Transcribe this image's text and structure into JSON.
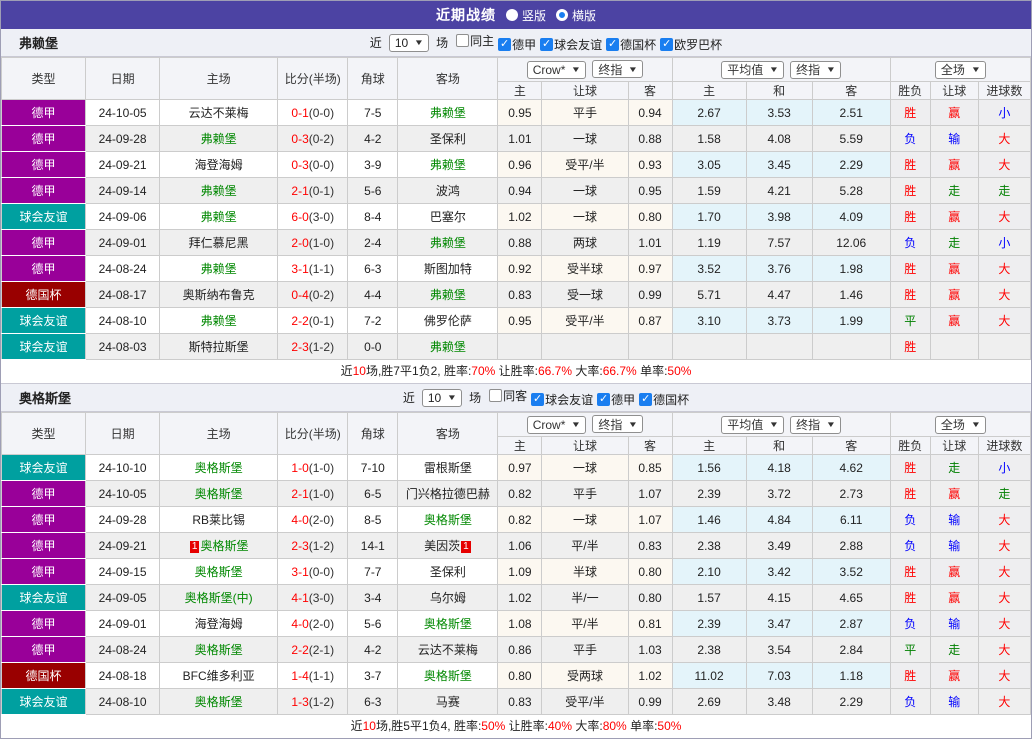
{
  "title_bar": {
    "title": "近期战绩",
    "radios": [
      {
        "label": "竖版",
        "checked": false
      },
      {
        "label": "横版",
        "checked": true
      }
    ]
  },
  "table": {
    "columns": {
      "left": [
        "类型",
        "日期",
        "主场",
        "比分(半场)",
        "角球",
        "客场"
      ],
      "sub": [
        "主",
        "让球",
        "客",
        "主",
        "和",
        "客",
        "胜负",
        "让球",
        "进球数"
      ]
    },
    "select_groups": [
      [
        "Crow*",
        "终指"
      ],
      [
        "平均值",
        "终指"
      ],
      [
        "全场"
      ]
    ]
  },
  "colors": {
    "titlebar": "#4c43a3",
    "type_badge": {
      "德甲": "#990099",
      "球会友谊": "#00a0a0",
      "德国杯": "#990000"
    },
    "result_text": {
      "胜": "#ff0000",
      "赢": "#ff0000",
      "大": "#ff0000",
      "负": "#0000ff",
      "输": "#0000ff",
      "小": "#0000ff",
      "平": "#008000",
      "走": "#008000"
    },
    "team_highlight": "#008800",
    "score_fulltime": "#ff0000"
  },
  "sections": [
    {
      "team": "弗赖堡",
      "filters": {
        "near_label": "近",
        "count": "10",
        "unit_label": "场",
        "checks": [
          {
            "label": "同主",
            "checked": false
          },
          {
            "label": "德甲",
            "checked": true
          },
          {
            "label": "球会友谊",
            "checked": true
          },
          {
            "label": "德国杯",
            "checked": true
          },
          {
            "label": "欧罗巴杯",
            "checked": true
          }
        ]
      },
      "rows": [
        {
          "type": "德甲",
          "date": "24-10-05",
          "home": {
            "name": "云达不莱梅"
          },
          "score": {
            "ft": "0-1",
            "ht": "(0-0)"
          },
          "corner": "7-5",
          "away": {
            "name": "弗赖堡",
            "green": true
          },
          "odds": [
            "0.95",
            "平手",
            "0.94"
          ],
          "avg": [
            "2.67",
            "3.53",
            "2.51"
          ],
          "result": [
            "胜",
            "赢",
            "小"
          ]
        },
        {
          "type": "德甲",
          "date": "24-09-28",
          "home": {
            "name": "弗赖堡",
            "green": true
          },
          "score": {
            "ft": "0-3",
            "ht": "(0-2)"
          },
          "corner": "4-2",
          "away": {
            "name": "圣保利"
          },
          "odds": [
            "1.01",
            "一球",
            "0.88"
          ],
          "avg": [
            "1.58",
            "4.08",
            "5.59"
          ],
          "result": [
            "负",
            "输",
            "大"
          ]
        },
        {
          "type": "德甲",
          "date": "24-09-21",
          "home": {
            "name": "海登海姆"
          },
          "score": {
            "ft": "0-3",
            "ht": "(0-0)"
          },
          "corner": "3-9",
          "away": {
            "name": "弗赖堡",
            "green": true
          },
          "odds": [
            "0.96",
            "受平/半",
            "0.93"
          ],
          "avg": [
            "3.05",
            "3.45",
            "2.29"
          ],
          "result": [
            "胜",
            "赢",
            "大"
          ]
        },
        {
          "type": "德甲",
          "date": "24-09-14",
          "home": {
            "name": "弗赖堡",
            "green": true
          },
          "score": {
            "ft": "2-1",
            "ht": "(0-1)"
          },
          "corner": "5-6",
          "away": {
            "name": "波鸿"
          },
          "odds": [
            "0.94",
            "一球",
            "0.95"
          ],
          "avg": [
            "1.59",
            "4.21",
            "5.28"
          ],
          "result": [
            "胜",
            "走",
            "走"
          ]
        },
        {
          "type": "球会友谊",
          "date": "24-09-06",
          "home": {
            "name": "弗赖堡",
            "green": true
          },
          "score": {
            "ft": "6-0",
            "ht": "(3-0)"
          },
          "corner": "8-4",
          "away": {
            "name": "巴塞尔"
          },
          "odds": [
            "1.02",
            "一球",
            "0.80"
          ],
          "avg": [
            "1.70",
            "3.98",
            "4.09"
          ],
          "result": [
            "胜",
            "赢",
            "大"
          ]
        },
        {
          "type": "德甲",
          "date": "24-09-01",
          "home": {
            "name": "拜仁慕尼黑"
          },
          "score": {
            "ft": "2-0",
            "ht": "(1-0)"
          },
          "corner": "2-4",
          "away": {
            "name": "弗赖堡",
            "green": true
          },
          "odds": [
            "0.88",
            "两球",
            "1.01"
          ],
          "avg": [
            "1.19",
            "7.57",
            "12.06"
          ],
          "result": [
            "负",
            "走",
            "小"
          ]
        },
        {
          "type": "德甲",
          "date": "24-08-24",
          "home": {
            "name": "弗赖堡",
            "green": true
          },
          "score": {
            "ft": "3-1",
            "ht": "(1-1)"
          },
          "corner": "6-3",
          "away": {
            "name": "斯图加特"
          },
          "odds": [
            "0.92",
            "受半球",
            "0.97"
          ],
          "avg": [
            "3.52",
            "3.76",
            "1.98"
          ],
          "result": [
            "胜",
            "赢",
            "大"
          ]
        },
        {
          "type": "德国杯",
          "date": "24-08-17",
          "home": {
            "name": "奥斯纳布鲁克"
          },
          "score": {
            "ft": "0-4",
            "ht": "(0-2)"
          },
          "corner": "4-4",
          "away": {
            "name": "弗赖堡",
            "green": true
          },
          "odds": [
            "0.83",
            "受一球",
            "0.99"
          ],
          "avg": [
            "5.71",
            "4.47",
            "1.46"
          ],
          "result": [
            "胜",
            "赢",
            "大"
          ]
        },
        {
          "type": "球会友谊",
          "date": "24-08-10",
          "home": {
            "name": "弗赖堡",
            "green": true
          },
          "score": {
            "ft": "2-2",
            "ht": "(0-1)"
          },
          "corner": "7-2",
          "away": {
            "name": "佛罗伦萨"
          },
          "odds": [
            "0.95",
            "受平/半",
            "0.87"
          ],
          "avg": [
            "3.10",
            "3.73",
            "1.99"
          ],
          "result": [
            "平",
            "赢",
            "大"
          ]
        },
        {
          "type": "球会友谊",
          "date": "24-08-03",
          "home": {
            "name": "斯特拉斯堡"
          },
          "score": {
            "ft": "2-3",
            "ht": "(1-2)"
          },
          "corner": "0-0",
          "away": {
            "name": "弗赖堡",
            "green": true
          },
          "odds": [
            "",
            "",
            ""
          ],
          "avg": [
            "",
            "",
            ""
          ],
          "result": [
            "胜",
            "",
            ""
          ]
        }
      ],
      "summary": [
        {
          "text": "近"
        },
        {
          "text": "10",
          "red": true
        },
        {
          "text": "场,胜7平1负2, 胜率:"
        },
        {
          "text": "70%",
          "red": true
        },
        {
          "text": " 让胜率:"
        },
        {
          "text": "66.7%",
          "red": true
        },
        {
          "text": " 大率:"
        },
        {
          "text": "66.7%",
          "red": true
        },
        {
          "text": " 单率:"
        },
        {
          "text": "50%",
          "red": true
        }
      ]
    },
    {
      "team": "奥格斯堡",
      "filters": {
        "near_label": "近",
        "count": "10",
        "unit_label": "场",
        "checks": [
          {
            "label": "同客",
            "checked": false
          },
          {
            "label": "球会友谊",
            "checked": true
          },
          {
            "label": "德甲",
            "checked": true
          },
          {
            "label": "德国杯",
            "checked": true
          }
        ]
      },
      "rows": [
        {
          "type": "球会友谊",
          "date": "24-10-10",
          "home": {
            "name": "奥格斯堡",
            "green": true
          },
          "score": {
            "ft": "1-0",
            "ht": "(1-0)"
          },
          "corner": "7-10",
          "away": {
            "name": "雷根斯堡"
          },
          "odds": [
            "0.97",
            "一球",
            "0.85"
          ],
          "avg": [
            "1.56",
            "4.18",
            "4.62"
          ],
          "result": [
            "胜",
            "走",
            "小"
          ]
        },
        {
          "type": "德甲",
          "date": "24-10-05",
          "home": {
            "name": "奥格斯堡",
            "green": true
          },
          "score": {
            "ft": "2-1",
            "ht": "(1-0)"
          },
          "corner": "6-5",
          "away": {
            "name": "门兴格拉德巴赫"
          },
          "odds": [
            "0.82",
            "平手",
            "1.07"
          ],
          "avg": [
            "2.39",
            "3.72",
            "2.73"
          ],
          "result": [
            "胜",
            "赢",
            "走"
          ]
        },
        {
          "type": "德甲",
          "date": "24-09-28",
          "home": {
            "name": "RB莱比锡"
          },
          "score": {
            "ft": "4-0",
            "ht": "(2-0)"
          },
          "corner": "8-5",
          "away": {
            "name": "奥格斯堡",
            "green": true
          },
          "odds": [
            "0.82",
            "一球",
            "1.07"
          ],
          "avg": [
            "1.46",
            "4.84",
            "6.11"
          ],
          "result": [
            "负",
            "输",
            "大"
          ]
        },
        {
          "type": "德甲",
          "date": "24-09-21",
          "home": {
            "name": "奥格斯堡",
            "green": true,
            "card": "1",
            "card_side": "left"
          },
          "score": {
            "ft": "2-3",
            "ht": "(1-2)"
          },
          "corner": "14-1",
          "away": {
            "name": "美因茨",
            "card": "1",
            "card_side": "right"
          },
          "odds": [
            "1.06",
            "平/半",
            "0.83"
          ],
          "avg": [
            "2.38",
            "3.49",
            "2.88"
          ],
          "result": [
            "负",
            "输",
            "大"
          ]
        },
        {
          "type": "德甲",
          "date": "24-09-15",
          "home": {
            "name": "奥格斯堡",
            "green": true
          },
          "score": {
            "ft": "3-1",
            "ht": "(0-0)"
          },
          "corner": "7-7",
          "away": {
            "name": "圣保利"
          },
          "odds": [
            "1.09",
            "半球",
            "0.80"
          ],
          "avg": [
            "2.10",
            "3.42",
            "3.52"
          ],
          "result": [
            "胜",
            "赢",
            "大"
          ]
        },
        {
          "type": "球会友谊",
          "date": "24-09-05",
          "home": {
            "name": "奥格斯堡(中)",
            "green": true
          },
          "score": {
            "ft": "4-1",
            "ht": "(3-0)"
          },
          "corner": "3-4",
          "away": {
            "name": "乌尔姆"
          },
          "odds": [
            "1.02",
            "半/一",
            "0.80"
          ],
          "avg": [
            "1.57",
            "4.15",
            "4.65"
          ],
          "result": [
            "胜",
            "赢",
            "大"
          ]
        },
        {
          "type": "德甲",
          "date": "24-09-01",
          "home": {
            "name": "海登海姆"
          },
          "score": {
            "ft": "4-0",
            "ht": "(2-0)"
          },
          "corner": "5-6",
          "away": {
            "name": "奥格斯堡",
            "green": true
          },
          "odds": [
            "1.08",
            "平/半",
            "0.81"
          ],
          "avg": [
            "2.39",
            "3.47",
            "2.87"
          ],
          "result": [
            "负",
            "输",
            "大"
          ]
        },
        {
          "type": "德甲",
          "date": "24-08-24",
          "home": {
            "name": "奥格斯堡",
            "green": true
          },
          "score": {
            "ft": "2-2",
            "ht": "(2-1)"
          },
          "corner": "4-2",
          "away": {
            "name": "云达不莱梅"
          },
          "odds": [
            "0.86",
            "平手",
            "1.03"
          ],
          "avg": [
            "2.38",
            "3.54",
            "2.84"
          ],
          "result": [
            "平",
            "走",
            "大"
          ]
        },
        {
          "type": "德国杯",
          "date": "24-08-18",
          "home": {
            "name": "BFC维多利亚"
          },
          "score": {
            "ft": "1-4",
            "ht": "(1-1)"
          },
          "corner": "3-7",
          "away": {
            "name": "奥格斯堡",
            "green": true
          },
          "odds": [
            "0.80",
            "受两球",
            "1.02"
          ],
          "avg": [
            "11.02",
            "7.03",
            "1.18"
          ],
          "result": [
            "胜",
            "赢",
            "大"
          ]
        },
        {
          "type": "球会友谊",
          "date": "24-08-10",
          "home": {
            "name": "奥格斯堡",
            "green": true
          },
          "score": {
            "ft": "1-3",
            "ht": "(1-2)"
          },
          "corner": "6-3",
          "away": {
            "name": "马赛"
          },
          "odds": [
            "0.83",
            "受平/半",
            "0.99"
          ],
          "avg": [
            "2.69",
            "3.48",
            "2.29"
          ],
          "result": [
            "负",
            "输",
            "大"
          ]
        }
      ],
      "summary": [
        {
          "text": "近"
        },
        {
          "text": "10",
          "red": true
        },
        {
          "text": "场,胜5平1负4, 胜率:"
        },
        {
          "text": "50%",
          "red": true
        },
        {
          "text": " 让胜率:"
        },
        {
          "text": "40%",
          "red": true
        },
        {
          "text": " 大率:"
        },
        {
          "text": "80%",
          "red": true
        },
        {
          "text": " 单率:"
        },
        {
          "text": "50%",
          "red": true
        }
      ]
    }
  ]
}
